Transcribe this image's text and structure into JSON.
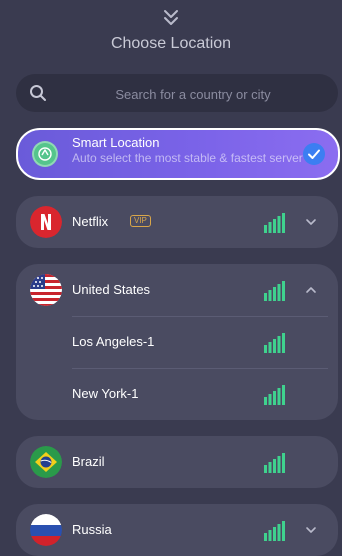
{
  "header": {
    "title": "Choose Location"
  },
  "search": {
    "placeholder": "Search for a country or city"
  },
  "smart": {
    "title": "Smart Location",
    "subtitle": "Auto select the most stable & fastest server",
    "selected": true
  },
  "locations": [
    {
      "name": "Netflix",
      "badge": "VIP",
      "signal_bars": 5,
      "expanded": false
    },
    {
      "name": "United States",
      "signal_bars": 5,
      "expanded": true,
      "cities": [
        {
          "name": "Los Angeles-1",
          "signal_bars": 5
        },
        {
          "name": "New York-1",
          "signal_bars": 5
        }
      ]
    },
    {
      "name": "Brazil",
      "signal_bars": 5,
      "expanded": false
    },
    {
      "name": "Russia",
      "signal_bars": 5,
      "expanded": false
    }
  ],
  "colors": {
    "background": "#3a3b50",
    "card": "#4a4b61",
    "accent": "#7a63e8",
    "signal": "#3fd28e",
    "check": "#3c7ef2",
    "vip": "#d8a64a"
  }
}
